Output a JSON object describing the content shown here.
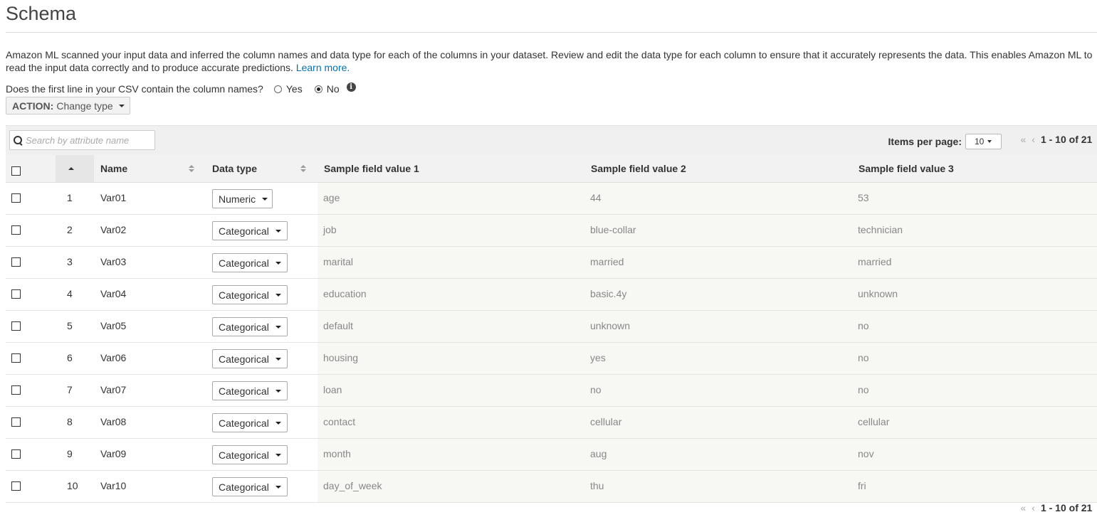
{
  "page": {
    "title": "Schema",
    "description": "Amazon ML scanned your input data and inferred the column names and data type for each of the columns in your dataset. Review and edit the data type for each column to ensure that it accurately represents the data. This enables Amazon ML to",
    "description_line2": "read the input data correctly and to produce accurate predictions.",
    "learn_more": "Learn more."
  },
  "csv_question": {
    "label": "Does the first line in your CSV contain the column names?",
    "options": [
      {
        "label": "Yes",
        "selected": false
      },
      {
        "label": "No",
        "selected": true
      }
    ]
  },
  "action_button": {
    "prefix": "ACTION:",
    "label": "Change type"
  },
  "toolbar": {
    "search_placeholder": "Search by attribute name",
    "items_per_page_label": "Items per page:",
    "items_per_page_value": "10",
    "pager_first": "«",
    "pager_prev": "‹",
    "pager_range": "1 - 10 of 21",
    "pager_next": "›"
  },
  "table": {
    "headers": {
      "name": "Name",
      "data_type": "Data type",
      "sample1": "Sample field value 1",
      "sample2": "Sample field value 2",
      "sample3": "Sample field value 3"
    },
    "rows": [
      {
        "index": "1",
        "name": "Var01",
        "type": "Numeric",
        "s1": "age",
        "s2": "44",
        "s3": "53"
      },
      {
        "index": "2",
        "name": "Var02",
        "type": "Categorical",
        "s1": "job",
        "s2": "blue-collar",
        "s3": "technician"
      },
      {
        "index": "3",
        "name": "Var03",
        "type": "Categorical",
        "s1": "marital",
        "s2": "married",
        "s3": "married"
      },
      {
        "index": "4",
        "name": "Var04",
        "type": "Categorical",
        "s1": "education",
        "s2": "basic.4y",
        "s3": "unknown"
      },
      {
        "index": "5",
        "name": "Var05",
        "type": "Categorical",
        "s1": "default",
        "s2": "unknown",
        "s3": "no"
      },
      {
        "index": "6",
        "name": "Var06",
        "type": "Categorical",
        "s1": "housing",
        "s2": "yes",
        "s3": "no"
      },
      {
        "index": "7",
        "name": "Var07",
        "type": "Categorical",
        "s1": "loan",
        "s2": "no",
        "s3": "no"
      },
      {
        "index": "8",
        "name": "Var08",
        "type": "Categorical",
        "s1": "contact",
        "s2": "cellular",
        "s3": "cellular"
      },
      {
        "index": "9",
        "name": "Var09",
        "type": "Categorical",
        "s1": "month",
        "s2": "aug",
        "s3": "nov"
      },
      {
        "index": "10",
        "name": "Var10",
        "type": "Categorical",
        "s1": "day_of_week",
        "s2": "thu",
        "s3": "fri"
      }
    ]
  },
  "icons": {
    "info": "info-icon",
    "search": "search-icon",
    "sort": "sort-icon"
  }
}
